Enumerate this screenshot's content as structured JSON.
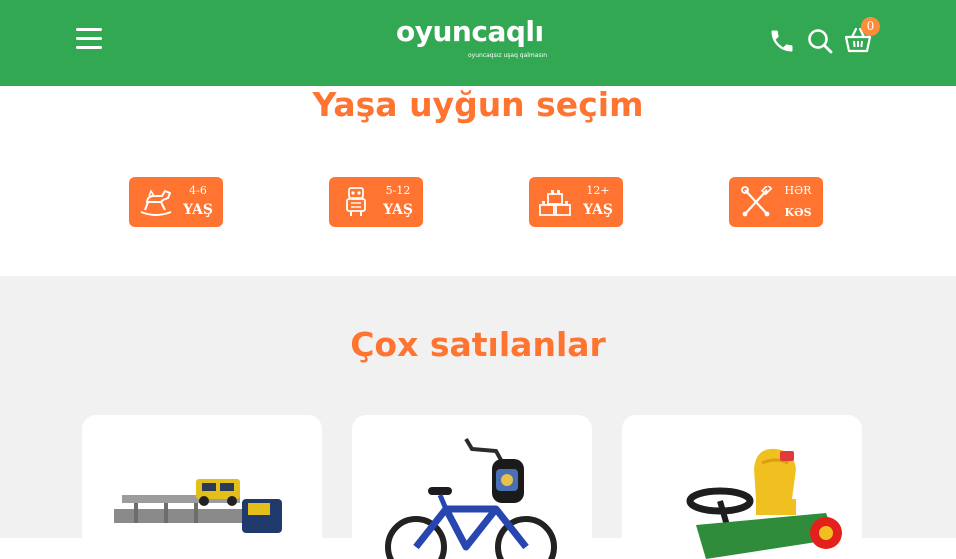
{
  "header": {
    "logo_text": "oyuncaqlı",
    "logo_tagline": "oyuncaqsız uşaq qalmasın",
    "cart_count": "0"
  },
  "age_section": {
    "title": "Yaşa uyğun seçim",
    "cards": [
      {
        "top": "4-6",
        "bottom": "YAŞ",
        "icon": "rocking-horse-icon"
      },
      {
        "top": "5-12",
        "bottom": "YAŞ",
        "icon": "robot-icon"
      },
      {
        "top": "12+",
        "bottom": "YAŞ",
        "icon": "blocks-icon"
      },
      {
        "top": "HƏR",
        "bottom": "KƏS",
        "icon": "crossed-tools-icon"
      }
    ]
  },
  "bestsellers": {
    "title": "Çox satılanlar",
    "products": [
      {
        "image": "car-transporter-truck-toy"
      },
      {
        "image": "blue-kids-bicycle"
      },
      {
        "image": "ride-on-tractor-toy"
      }
    ]
  },
  "colors": {
    "brand_green": "#33a853",
    "accent_orange": "#ff7430",
    "section_grey": "#f1f1f1"
  }
}
